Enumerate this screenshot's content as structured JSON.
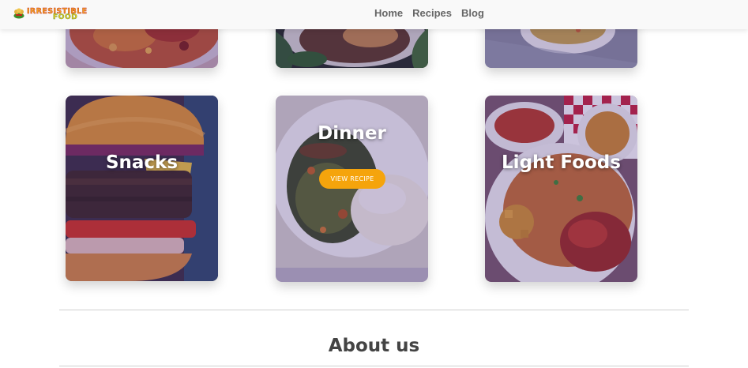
{
  "brand": {
    "logo_word1": "IRRESISTIBLE",
    "logo_word2": "FOOD",
    "logo_icon": "chef-hat-icon"
  },
  "nav": {
    "items": [
      "Home",
      "Recipes",
      "Blog"
    ]
  },
  "categories": [
    {
      "title": "Snacks"
    },
    {
      "title": "Dinner",
      "button": "VIEW RECIPE"
    },
    {
      "title": "Light Foods"
    }
  ],
  "about": {
    "title": "About us"
  },
  "colors": {
    "accent": "#f5a40c",
    "overlay": "#46288a",
    "nav_text": "#666666"
  }
}
